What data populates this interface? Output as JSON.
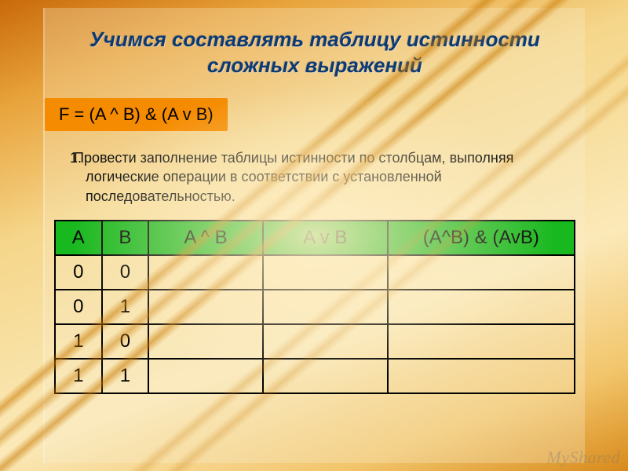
{
  "title_line1": "Учимся составлять таблицу истинности",
  "title_line2": "сложных выражений",
  "formula": "F = (A ^ B) & (A v B)",
  "paragraph_num": "1.",
  "paragraph": "Провести заполнение таблицы истинности по столбцам, выполняя логические операции в соответствии с установленной последовательностью.",
  "headers": {
    "c1": "A",
    "c2": "B",
    "c3": "A ^ B",
    "c4": "A v B",
    "c5": "(A^B) & (AvB)"
  },
  "rows": [
    {
      "a": "0",
      "b": "0",
      "c": "",
      "d": "",
      "e": ""
    },
    {
      "a": "0",
      "b": "1",
      "c": "",
      "d": "",
      "e": ""
    },
    {
      "a": "1",
      "b": "0",
      "c": "",
      "d": "",
      "e": ""
    },
    {
      "a": "1",
      "b": "1",
      "c": "",
      "d": "",
      "e": ""
    }
  ],
  "watermark": "MyShared"
}
